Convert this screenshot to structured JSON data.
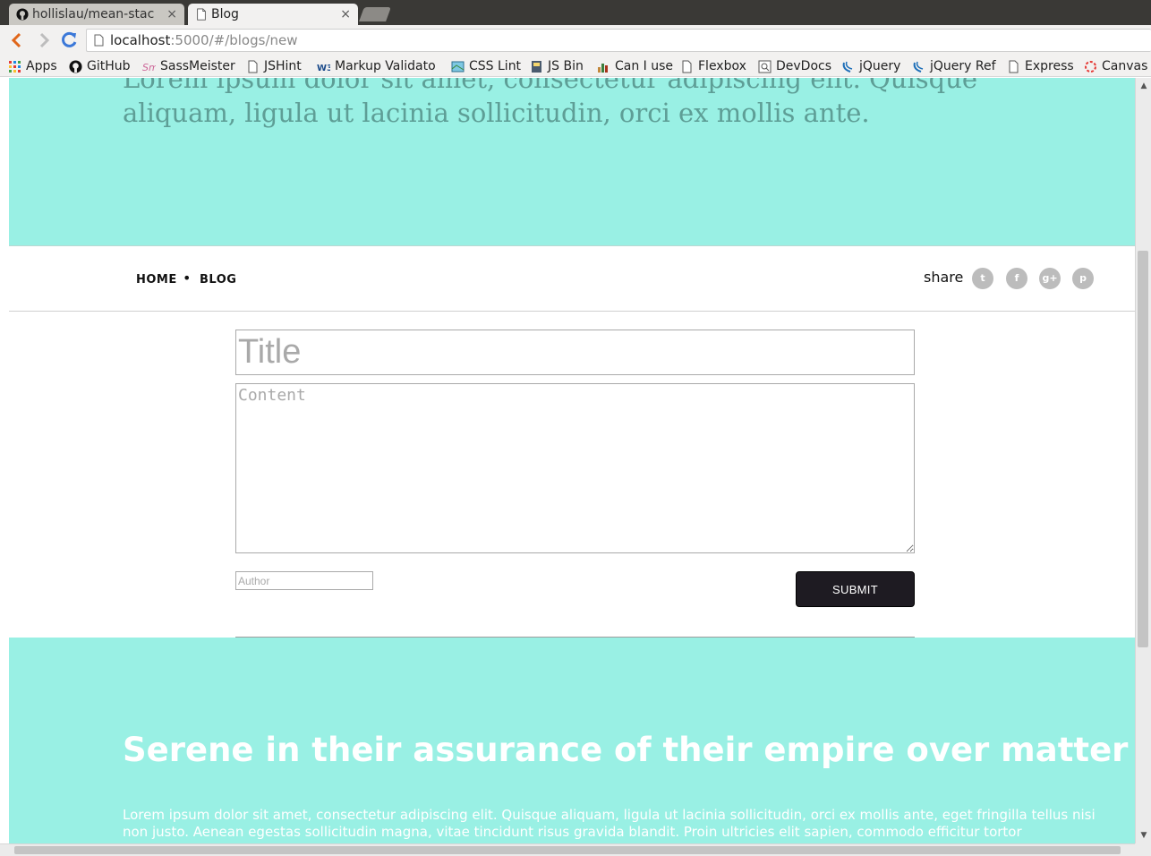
{
  "browser": {
    "tabs": [
      {
        "label": "hollislau/mean-stac",
        "close": "×",
        "icon": "github-icon",
        "active": false
      },
      {
        "label": "Blog",
        "close": "×",
        "icon": "page-icon",
        "active": true
      }
    ],
    "url_host": "localhost",
    "url_path": ":5000/#/blogs/new",
    "bookmarks": [
      {
        "label": "Apps",
        "icon": "apps-grid-icon"
      },
      {
        "label": "GitHub",
        "icon": "github-icon"
      },
      {
        "label": "SassMeister",
        "icon": "sassmeister-icon"
      },
      {
        "label": "JSHint",
        "icon": "page-icon"
      },
      {
        "label": "Markup Validato",
        "icon": "w3c-icon"
      },
      {
        "label": "CSS Lint",
        "icon": "csslint-icon"
      },
      {
        "label": "JS Bin",
        "icon": "jsbin-icon"
      },
      {
        "label": "Can I use",
        "icon": "caniuse-icon"
      },
      {
        "label": "Flexbox",
        "icon": "page-icon"
      },
      {
        "label": "DevDocs",
        "icon": "devdocs-icon"
      },
      {
        "label": "jQuery",
        "icon": "jquery-icon"
      },
      {
        "label": "jQuery Ref",
        "icon": "jquery-icon"
      },
      {
        "label": "Express",
        "icon": "page-icon"
      },
      {
        "label": "Canvas",
        "icon": "canvas-icon"
      }
    ]
  },
  "hero": {
    "text": "Lorem ipsum dolor sit amet, consectetur adipiscing elit. Quisque aliquam, ligula ut lacinia sollicitudin, orci ex mollis ante."
  },
  "nav": {
    "home": "HOME",
    "separator": "•",
    "blog": "BLOG",
    "share_label": "share",
    "social": [
      {
        "name": "twitter-icon",
        "glyph": "t"
      },
      {
        "name": "facebook-icon",
        "glyph": "f"
      },
      {
        "name": "google-plus-icon",
        "glyph": "g+"
      },
      {
        "name": "pinterest-icon",
        "glyph": "p"
      }
    ]
  },
  "form": {
    "title_placeholder": "Title",
    "content_placeholder": "Content",
    "author_placeholder": "Author",
    "submit_label": "SUBMIT"
  },
  "footer": {
    "heading": "Serene in their assurance of their empire over matter",
    "body": "Lorem ipsum dolor sit amet, consectetur adipiscing elit. Quisque aliquam, ligula ut lacinia sollicitudin, orci ex mollis ante, eget fringilla tellus nisi non justo. Aenean egestas sollicitudin magna, vitae tincidunt risus gravida blandit. Proin ultricies elit sapien, commodo efficitur tortor"
  },
  "colors": {
    "accent_teal": "#99f0e4",
    "submit_bg": "#1e1b22",
    "hero_text": "#5e9e96"
  }
}
